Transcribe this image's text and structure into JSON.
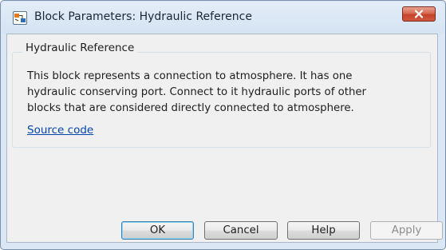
{
  "window": {
    "title": "Block Parameters: Hydraulic Reference",
    "close_icon": "close-icon",
    "app_icon": "simulink-block-icon"
  },
  "group": {
    "title": "Hydraulic Reference",
    "description_lines": [
      "This block represents a connection to atmosphere. It has one",
      "hydraulic conserving port. Connect to it hydraulic ports of other",
      "blocks that are considered directly connected to atmosphere."
    ],
    "source_link": "Source code"
  },
  "buttons": {
    "ok": "OK",
    "cancel": "Cancel",
    "help": "Help",
    "apply": "Apply"
  },
  "colors": {
    "link": "#0645ad",
    "close_button": "#c4432b",
    "frame": "#dbe7f5"
  }
}
